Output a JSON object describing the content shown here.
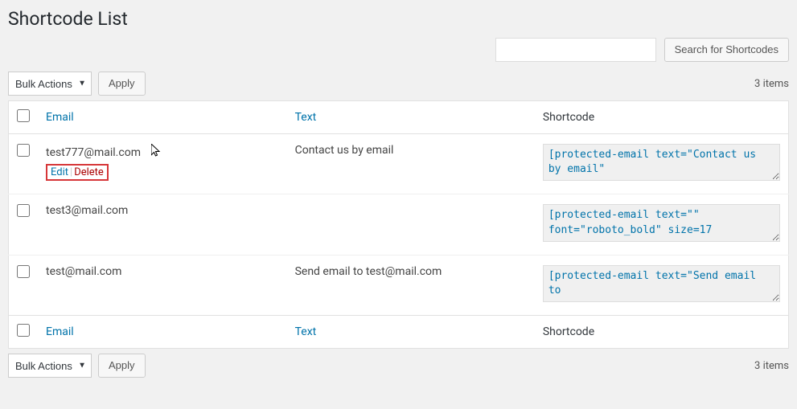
{
  "page": {
    "title": "Shortcode List"
  },
  "search": {
    "value": "",
    "button": "Search for Shortcodes"
  },
  "bulk": {
    "label": "Bulk Actions",
    "apply": "Apply"
  },
  "count": "3 items",
  "columns": {
    "email": "Email",
    "text": "Text",
    "shortcode": "Shortcode"
  },
  "actions": {
    "edit": "Edit",
    "delete": "Delete"
  },
  "rows": [
    {
      "email": "test777@mail.com",
      "text": "Contact us by email",
      "shortcode": "[protected-email text=\"Contact us by email\""
    },
    {
      "email": "test3@mail.com",
      "text": "",
      "shortcode": "[protected-email text=\"\" font=\"roboto_bold\" size=17"
    },
    {
      "email": "test@mail.com",
      "text": "Send email to test@mail.com",
      "shortcode": "[protected-email text=\"Send email to"
    }
  ]
}
